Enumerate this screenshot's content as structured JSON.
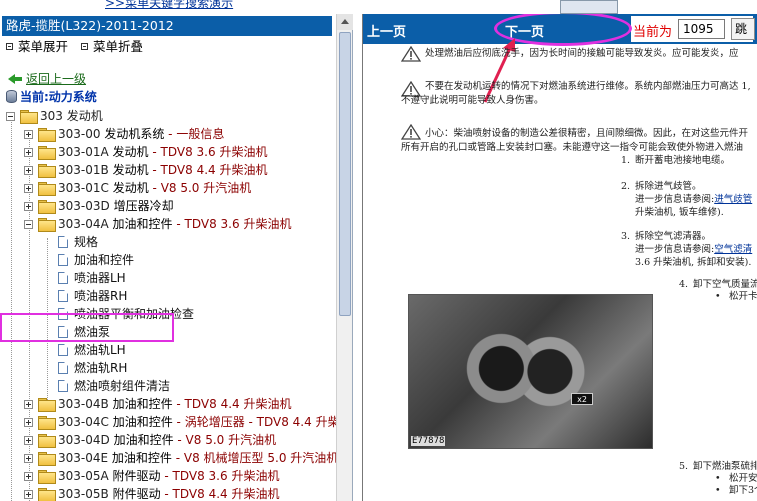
{
  "top": {
    "link_text": ">>菜单关键字搜索演示"
  },
  "tree_pane": {
    "title": "路虎-揽胜(L322)-2011-2012",
    "expand_all": "菜单展开",
    "collapse_all": "菜单折叠",
    "back": "返回上一级",
    "current": "当前:动力系统",
    "root": "303 发动机",
    "items": [
      {
        "code": "303-00",
        "title": "发动机系统",
        "sub": " - 一般信息",
        "expanded": false
      },
      {
        "code": "303-01A",
        "title": "发动机",
        "sub": " - TDV8 3.6 升柴油机",
        "expanded": false
      },
      {
        "code": "303-01B",
        "title": "发动机",
        "sub": " - TDV8 4.4 升柴油机",
        "expanded": false
      },
      {
        "code": "303-01C",
        "title": "发动机",
        "sub": " - V8 5.0 升汽油机",
        "expanded": false
      },
      {
        "code": "303-03D",
        "title": "增压器冷却",
        "sub": "",
        "expanded": false
      },
      {
        "code": "303-04A",
        "title": "加油和控件",
        "sub": " - TDV8 3.6 升柴油机",
        "expanded": true
      },
      {
        "code": "303-04B",
        "title": "加油和控件",
        "sub": " - TDV8 4.4 升柴油机",
        "expanded": false
      },
      {
        "code": "303-04C",
        "title": "加油和控件",
        "sub": " - 涡轮增压器 - TDV8 4.4 升柴",
        "expanded": false
      },
      {
        "code": "303-04D",
        "title": "加油和控件",
        "sub": " - V8 5.0 升汽油机",
        "expanded": false
      },
      {
        "code": "303-04E",
        "title": "加油和控件",
        "sub": " - V8 机械增压型 5.0 升汽油机",
        "expanded": false
      },
      {
        "code": "303-05A",
        "title": "附件驱动",
        "sub": " - TDV8 3.6 升柴油机",
        "expanded": false
      },
      {
        "code": "303-05B",
        "title": "附件驱动",
        "sub": " - TDV8 4.4 升柴油机",
        "expanded": false
      }
    ],
    "children_303_04A": [
      "规格",
      "加油和控件",
      "喷油器LH",
      "喷油器RH",
      "喷油器平衡和加油检查",
      "燃油泵",
      "燃油轨LH",
      "燃油轨RH",
      "燃油喷射组件清洁"
    ]
  },
  "doc_pane": {
    "prev": "上一页",
    "next": "下一页",
    "current_page_label": "当前为",
    "current_page": "1095",
    "jump": "跳",
    "warnings": [
      "处理燃油后应彻底洗手，因为长时间的接触可能导致发炎。应可能发炎，应",
      "不要在发动机运转的情况下对燃油系统进行维修。系统内部燃油压力可高达 1,",
      "不遵守此说明可能导致人身伤害。",
      "小心：柴油喷射设备的制造公差很精密，且间隙细微。因此，在对这些元件开",
      "所有开启的孔口或管路上安装封口塞。未能遵守这一指令可能会致使外物进入燃油"
    ],
    "steps": [
      {
        "num": "1.",
        "text": "断开蓄电池接地电缆。"
      },
      {
        "num": "2.",
        "text": "拆除进气歧管。"
      },
      {
        "num": "",
        "text": "进一步信息请参阅:",
        "link": "进气歧管"
      },
      {
        "num": "",
        "text": "升柴油机, 钣车维修)."
      },
      {
        "num": "3.",
        "text": "拆除空气滤清器。"
      },
      {
        "num": "",
        "text": "进一步信息请参阅:",
        "link": "空气滤清"
      },
      {
        "num": "",
        "text": "3.6 升柴油机, 拆卸和安装)."
      }
    ],
    "sub_steps": [
      {
        "num": "4.",
        "text": "卸下空气质量流"
      },
      {
        "num": "•",
        "text": "松开卡"
      },
      {
        "num": "5.",
        "text": "卸下燃油泵硫排"
      },
      {
        "num": "•",
        "text": "松开安"
      },
      {
        "num": "•",
        "text": "卸下3个"
      }
    ],
    "photo_caption": "E77878",
    "photo_tag": "x2"
  }
}
